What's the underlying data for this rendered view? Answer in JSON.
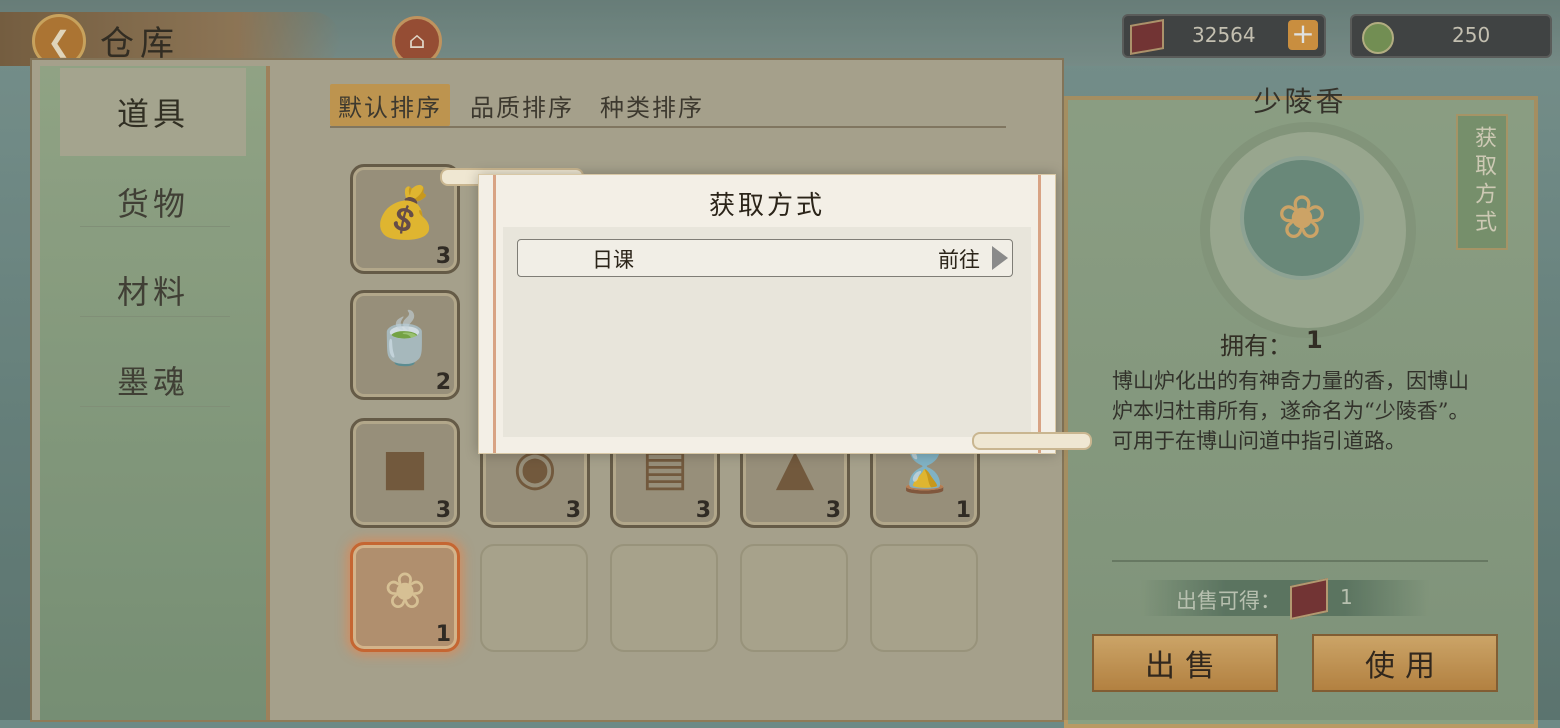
{
  "header": {
    "title": "仓库",
    "currency1": {
      "icon": "ink-box-icon",
      "value": "32564"
    },
    "currency2": {
      "icon": "jade-coin-icon",
      "value": "250"
    }
  },
  "sidebar": {
    "items": [
      {
        "label": "道具",
        "active": true
      },
      {
        "label": "货物",
        "active": false
      },
      {
        "label": "材料",
        "active": false
      },
      {
        "label": "墨魂",
        "active": false
      }
    ]
  },
  "sort_tabs": [
    {
      "label": "默认排序",
      "active": true
    },
    {
      "label": "品质排序",
      "active": false
    },
    {
      "label": "种类排序",
      "active": false
    }
  ],
  "grid": {
    "slots": [
      {
        "icon": "pouch-icon",
        "count": "3"
      },
      {
        "icon": "tea-jar-icon",
        "count": "2"
      },
      {
        "icon": "tank-icon",
        "count": "3"
      },
      {
        "icon": "drum-kit-icon",
        "count": "3"
      },
      {
        "icon": "books-icon",
        "count": "3"
      },
      {
        "icon": "hat-icon",
        "count": "3"
      },
      {
        "icon": "hourglass-icon",
        "count": "1"
      },
      {
        "icon": "incense-flower-icon",
        "count": "1",
        "selected": true
      }
    ]
  },
  "detail": {
    "name": "少陵香",
    "get_tag": "获取方式",
    "owned_label": "拥有：",
    "owned_value": "1",
    "description": "博山炉化出的有神奇力量的香，因博山炉本归杜甫所有，遂命名为“少陵香”。可用于在博山问道中指引道路。",
    "sell_label": "出售可得：",
    "sell_value": "1",
    "sell_button": "出售",
    "use_button": "使用"
  },
  "popup": {
    "title": "获取方式",
    "routes": [
      {
        "name": "日课",
        "action": "前往"
      }
    ]
  }
}
